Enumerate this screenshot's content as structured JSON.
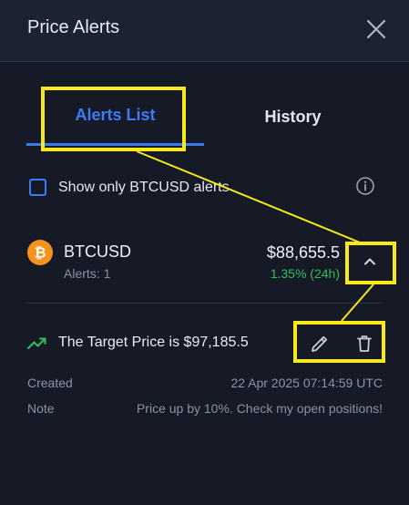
{
  "header": {
    "title": "Price Alerts",
    "close_icon": "close-icon"
  },
  "tabs": [
    {
      "label": "Alerts List",
      "active": true
    },
    {
      "label": "History",
      "active": false
    }
  ],
  "filter": {
    "label": "Show only BTCUSD alerts",
    "checked": false,
    "info_icon": "info-icon"
  },
  "asset": {
    "icon": "bitcoin-icon",
    "symbol": "BTCUSD",
    "alerts_count": "Alerts: 1",
    "price": "$88,655.5",
    "change": "1.35% (24h)",
    "expanded": true
  },
  "alert": {
    "trend_icon": "trending-up-icon",
    "target_text": "The Target Price is $97,185.5",
    "created_label": "Created",
    "created_value": "22 Apr 2025 07:14:59 UTC",
    "note_label": "Note",
    "note_value": "Price up by 10%. Check my open positions!"
  },
  "colors": {
    "background": "#151a26",
    "header_bg": "#1b2231",
    "accent": "#3d7bf5",
    "positive": "#2fbf5a",
    "bitcoin": "#f7931a",
    "annotation": "#f7ea1b"
  }
}
